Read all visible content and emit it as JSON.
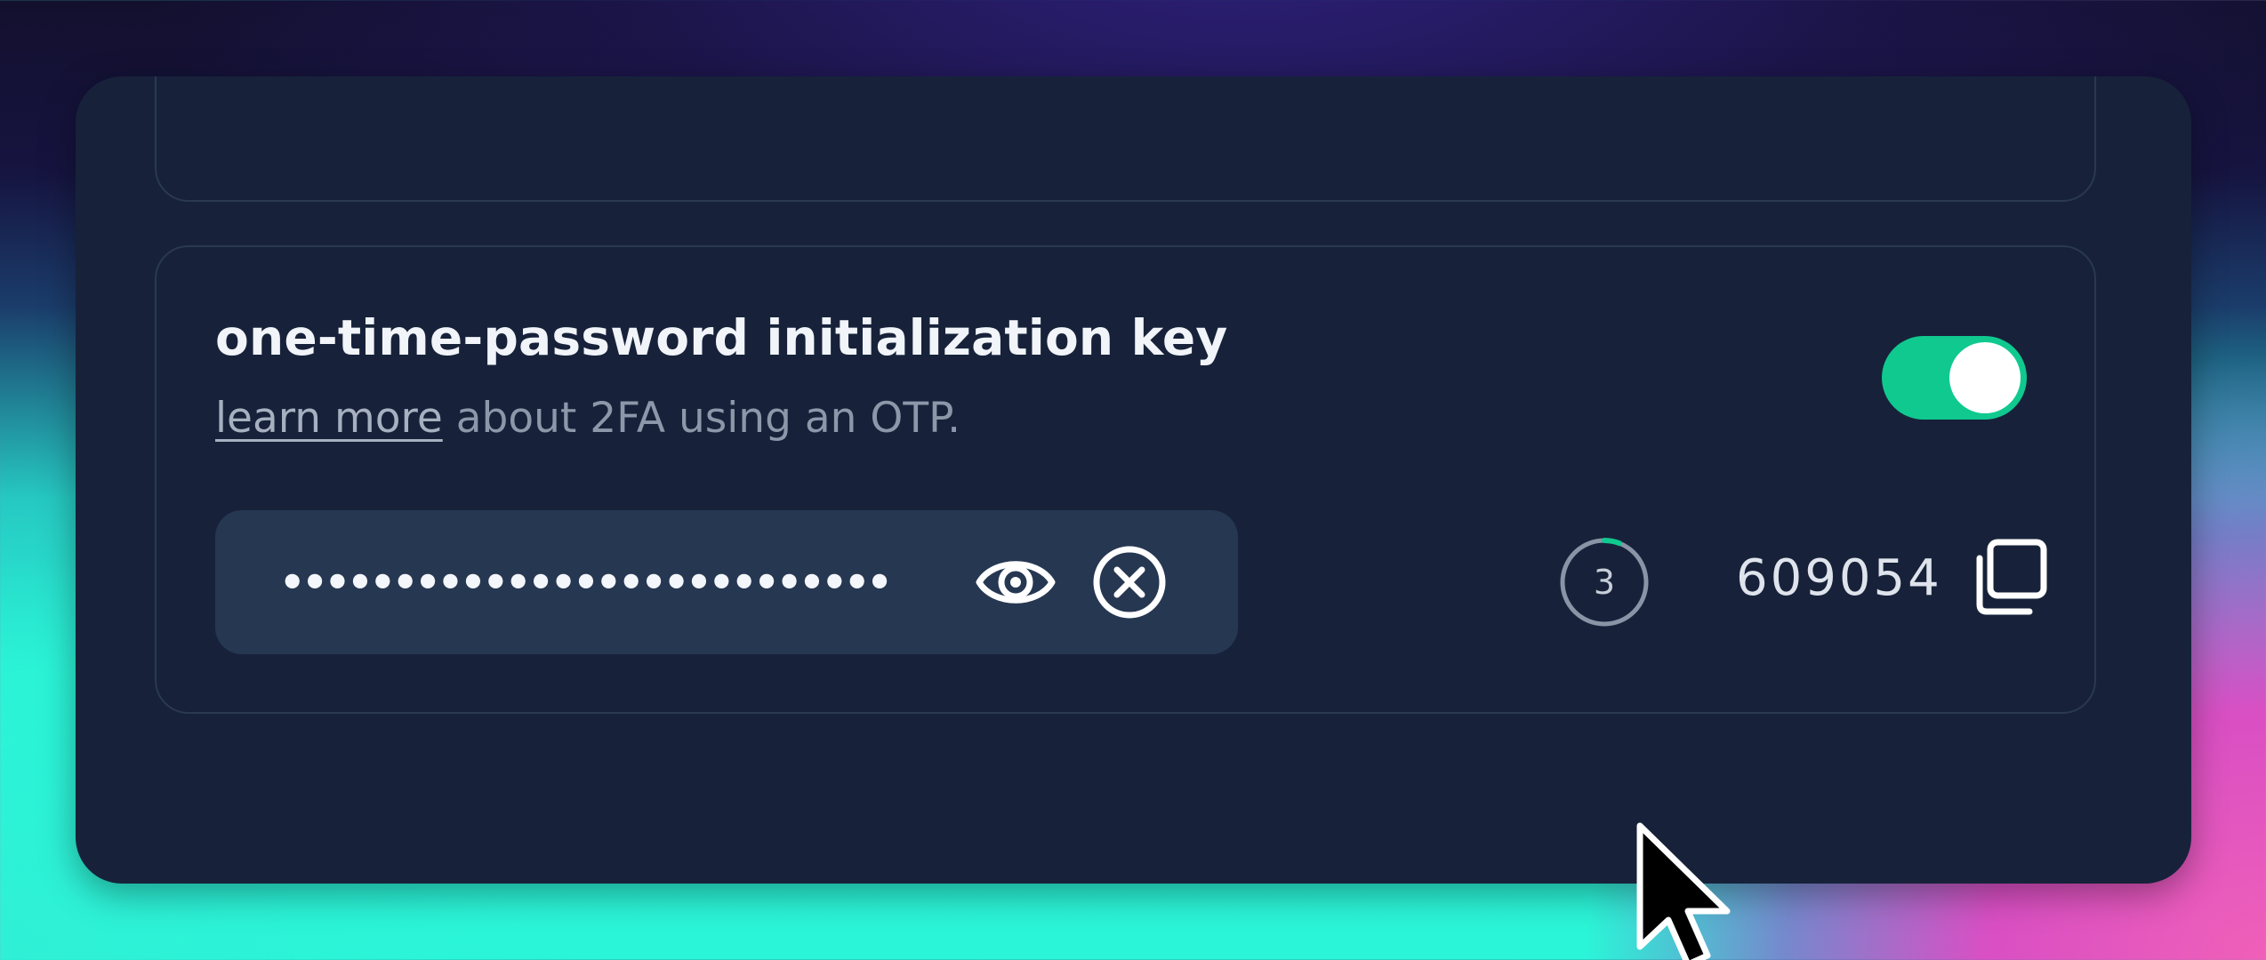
{
  "settings_card": {
    "title": "one-time-password initialization key",
    "subtitle_link": "learn more",
    "subtitle_rest": " about 2FA using an OTP.",
    "toggle_enabled": true,
    "secret_masked": "•••••••••••••••••••••••••••",
    "reveal_icon": "eye-icon",
    "clear_icon": "x-circle-icon",
    "timer_seconds": "3",
    "otp_code": "609054",
    "copy_icon": "copy-icon"
  },
  "colors": {
    "accent": "#10c98f",
    "panel": "#17223a",
    "field": "#263752"
  }
}
